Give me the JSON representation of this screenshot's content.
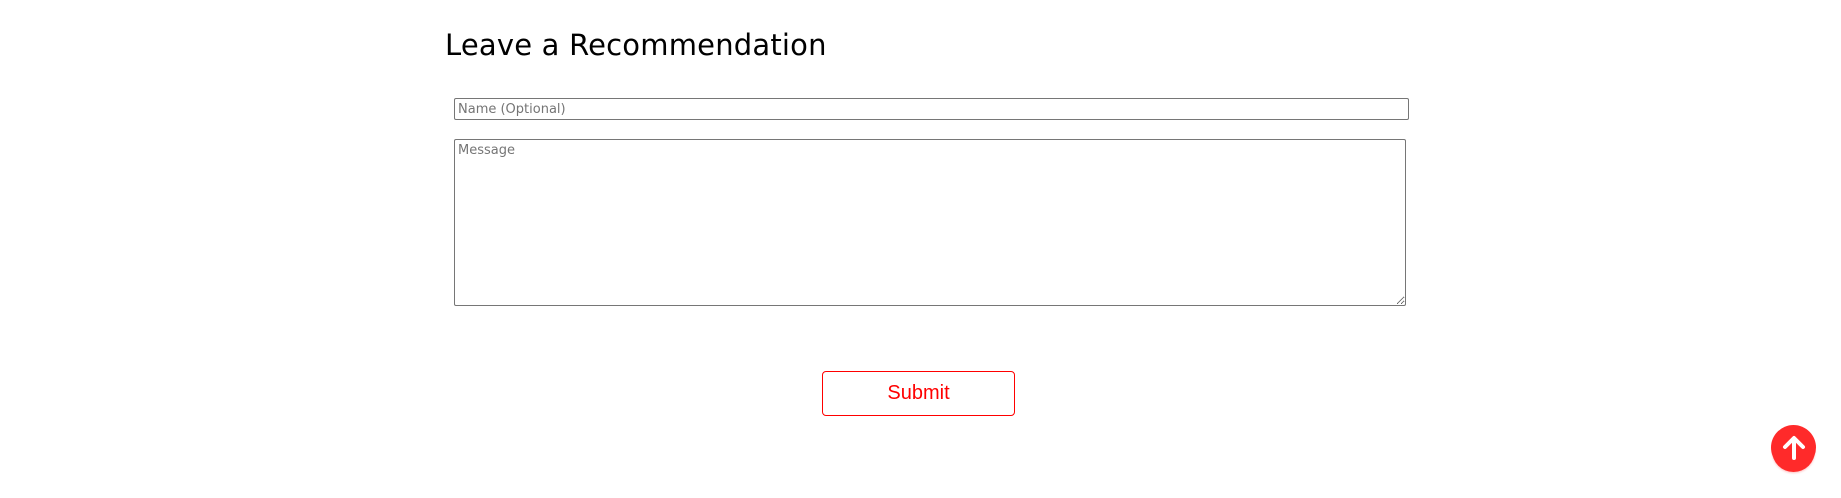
{
  "form": {
    "title": "Leave a Recommendation",
    "name_field": {
      "placeholder": "Name (Optional)",
      "value": ""
    },
    "message_field": {
      "placeholder": "Message",
      "value": ""
    },
    "submit_label": "Submit"
  },
  "scroll_top": {
    "icon": "arrow-up-icon"
  },
  "colors": {
    "accent": "#ff0000",
    "scroll_top_bg": "#ff2a2a",
    "text": "#000000",
    "border": "#767676"
  }
}
